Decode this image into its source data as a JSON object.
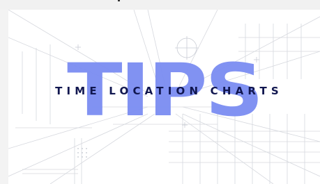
{
  "graphic": {
    "big_word": "TIPS",
    "subtitle": "TIME LOCATION CHARTS"
  },
  "colors": {
    "big_word": "#7b8df2",
    "subtitle": "#10164f",
    "grid_lines": "#d6d8de",
    "background": "#ffffff"
  }
}
